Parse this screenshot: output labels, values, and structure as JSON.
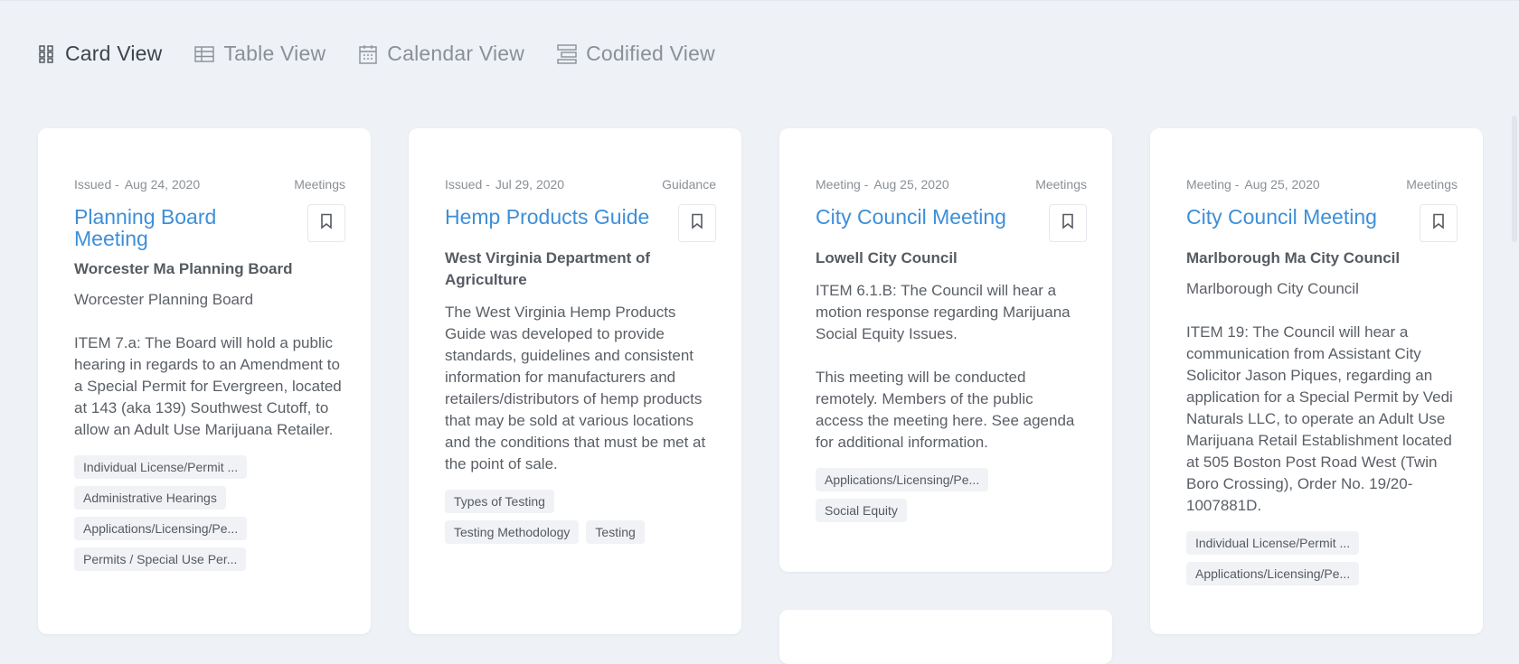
{
  "view_tabs": [
    {
      "label": "Card View",
      "icon": "grid-icon",
      "active": true
    },
    {
      "label": "Table View",
      "icon": "table-icon",
      "active": false
    },
    {
      "label": "Calendar View",
      "icon": "calendar-icon",
      "active": false
    },
    {
      "label": "Codified View",
      "icon": "codified-icon",
      "active": false
    }
  ],
  "cards": [
    {
      "meta_type": "Issued -",
      "meta_date": "Aug 24, 2020",
      "category": "Meetings",
      "title": "Planning Board Meeting",
      "agency": "Worcester Ma Planning Board",
      "subtitle": "Worcester Planning Board",
      "description": "ITEM 7.a: The Board will hold a public hearing in regards to an Amendment to a Special Permit for Evergreen, located at 143 (aka 139) Southwest Cutoff, to allow an Adult Use Marijuana Retailer.",
      "tags": [
        "Individual License/Permit ...",
        "Administrative Hearings",
        "Applications/Licensing/Pe...",
        "Permits / Special Use Per..."
      ]
    },
    {
      "meta_type": "Issued -",
      "meta_date": "Jul 29, 2020",
      "category": "Guidance",
      "title": "Hemp Products Guide",
      "agency": "West Virginia Department of Agriculture",
      "subtitle": "",
      "description": "The West Virginia Hemp Products Guide was developed to provide standards, guidelines and consistent information for manufacturers and retailers/distributors of hemp products that may be sold at various locations and the conditions that must be met at the point of sale.",
      "tags": [
        "Types of Testing",
        "Testing Methodology",
        "Testing"
      ]
    },
    {
      "meta_type": "Meeting -",
      "meta_date": "Aug 25, 2020",
      "category": "Meetings",
      "title": "City Council Meeting",
      "agency": "Lowell City Council",
      "subtitle": "",
      "description": "ITEM 6.1.B: The Council will hear a motion response regarding Marijuana Social Equity Issues.\n\nThis meeting will be conducted remotely. Members of the public access the meeting here. See agenda for additional information.",
      "tags": [
        "Applications/Licensing/Pe...",
        "Social Equity"
      ]
    },
    {
      "meta_type": "Meeting -",
      "meta_date": "Aug 25, 2020",
      "category": "Meetings",
      "title": "City Council Meeting",
      "agency": "Marlborough Ma City Council",
      "subtitle": "Marlborough City Council",
      "description": "ITEM 19: The Council will hear a communication from Assistant City Solicitor Jason Piques, regarding an application for a Special Permit by Vedi Naturals LLC, to operate an Adult Use Marijuana Retail Establishment located at 505 Boston Post Road West (Twin Boro Crossing), Order No. 19/20-1007881D.",
      "tags": [
        "Individual License/Permit ...",
        "Applications/Licensing/Pe..."
      ]
    }
  ]
}
